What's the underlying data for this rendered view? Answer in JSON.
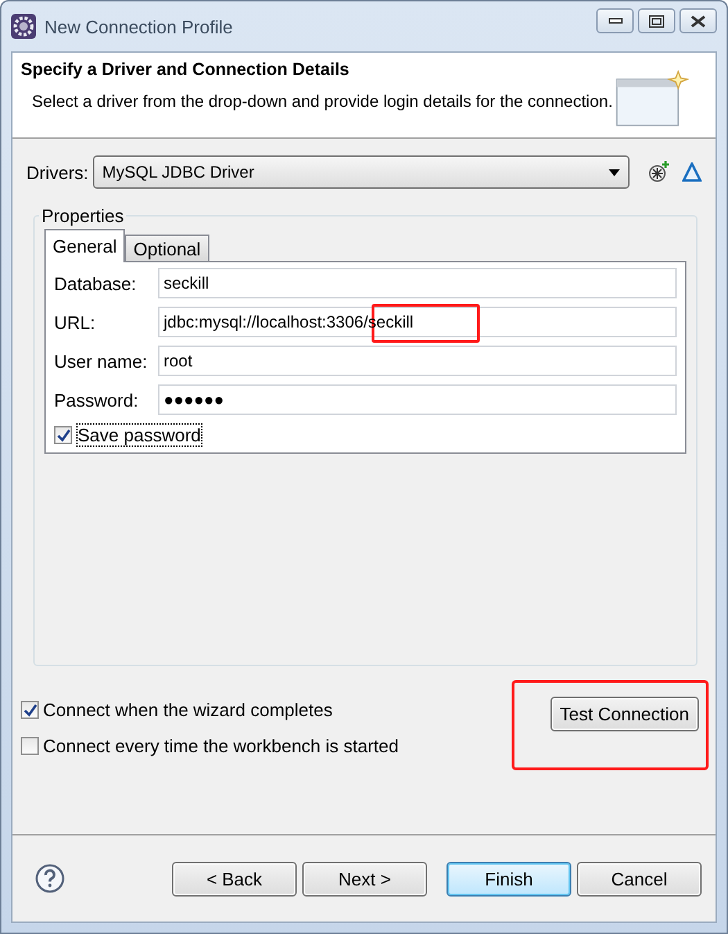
{
  "window": {
    "title": "New Connection Profile"
  },
  "header": {
    "title": "Specify a Driver and Connection Details",
    "description": "Select a driver from the drop-down and provide login details for the connection."
  },
  "drivers": {
    "label": "Drivers:",
    "value": "MySQL JDBC Driver"
  },
  "properties": {
    "title": "Properties",
    "tabs": [
      {
        "label": "General",
        "selected": true
      },
      {
        "label": "Optional",
        "selected": false
      }
    ],
    "fields": [
      {
        "label": "Database:",
        "value": "seckill",
        "annotated": false
      },
      {
        "label": "URL:",
        "value": "jdbc:mysql://localhost:3306/seckill",
        "annotated": true
      },
      {
        "label": "User name:",
        "value": "root",
        "annotated": false
      },
      {
        "label": "Password:",
        "value": "●●●●●●",
        "annotated": false
      }
    ],
    "save_password": {
      "label": "Save password",
      "checked": true
    }
  },
  "options": [
    {
      "label": "Connect when the wizard completes",
      "checked": true
    },
    {
      "label": "Connect every time the workbench is started",
      "checked": false
    }
  ],
  "test_button": {
    "label": "Test Connection",
    "annotated": true
  },
  "buttons": [
    {
      "label": "< Back",
      "default": false
    },
    {
      "label": "Next >",
      "default": false
    },
    {
      "label": "Finish",
      "default": true
    },
    {
      "label": "Cancel",
      "default": false
    }
  ]
}
